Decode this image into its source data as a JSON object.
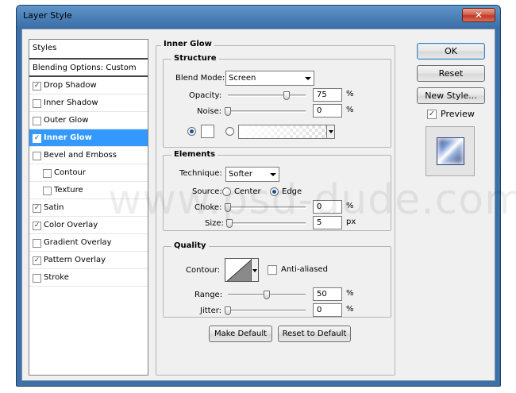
{
  "window": {
    "title": "Layer Style",
    "close_glyph": "✕"
  },
  "styles": {
    "header": "Styles",
    "blending_options": "Blending Options: Custom",
    "items": [
      {
        "label": "Drop Shadow",
        "checked": true,
        "indent": false,
        "selected": false
      },
      {
        "label": "Inner Shadow",
        "checked": false,
        "indent": false,
        "selected": false
      },
      {
        "label": "Outer Glow",
        "checked": false,
        "indent": false,
        "selected": false
      },
      {
        "label": "Inner Glow",
        "checked": true,
        "indent": false,
        "selected": true
      },
      {
        "label": "Bevel and Emboss",
        "checked": false,
        "indent": false,
        "selected": false
      },
      {
        "label": "Contour",
        "checked": false,
        "indent": true,
        "selected": false
      },
      {
        "label": "Texture",
        "checked": false,
        "indent": true,
        "selected": false
      },
      {
        "label": "Satin",
        "checked": true,
        "indent": false,
        "selected": false
      },
      {
        "label": "Color Overlay",
        "checked": true,
        "indent": false,
        "selected": false
      },
      {
        "label": "Gradient Overlay",
        "checked": false,
        "indent": false,
        "selected": false
      },
      {
        "label": "Pattern Overlay",
        "checked": true,
        "indent": false,
        "selected": false
      },
      {
        "label": "Stroke",
        "checked": false,
        "indent": false,
        "selected": false
      }
    ]
  },
  "inner_glow": {
    "title": "Inner Glow",
    "structure": {
      "title": "Structure",
      "blend_mode_label": "Blend Mode:",
      "blend_mode_value": "Screen",
      "opacity_label": "Opacity:",
      "opacity_value": "75",
      "opacity_level": 0.75,
      "noise_label": "Noise:",
      "noise_value": "0",
      "noise_level": 0,
      "percent": "%",
      "color_mode": "solid",
      "color": "#ffffff"
    },
    "elements": {
      "title": "Elements",
      "technique_label": "Technique:",
      "technique_value": "Softer",
      "source_label": "Source:",
      "source_center": "Center",
      "source_edge": "Edge",
      "source_selected": "Edge",
      "choke_label": "Choke:",
      "choke_value": "0",
      "choke_level": 0,
      "choke_unit": "%",
      "size_label": "Size:",
      "size_value": "5",
      "size_level": 0.02,
      "size_unit": "px"
    },
    "quality": {
      "title": "Quality",
      "contour_label": "Contour:",
      "anti_aliased_label": "Anti-aliased",
      "anti_aliased_checked": false,
      "range_label": "Range:",
      "range_value": "50",
      "range_level": 0.5,
      "range_unit": "%",
      "jitter_label": "Jitter:",
      "jitter_value": "0",
      "jitter_level": 0,
      "jitter_unit": "%"
    },
    "make_default": "Make Default",
    "reset_default": "Reset to Default"
  },
  "actions": {
    "ok": "OK",
    "reset": "Reset",
    "new_style": "New Style...",
    "preview_label": "Preview",
    "preview_checked": true
  },
  "watermark": "www.psd-dude.com"
}
